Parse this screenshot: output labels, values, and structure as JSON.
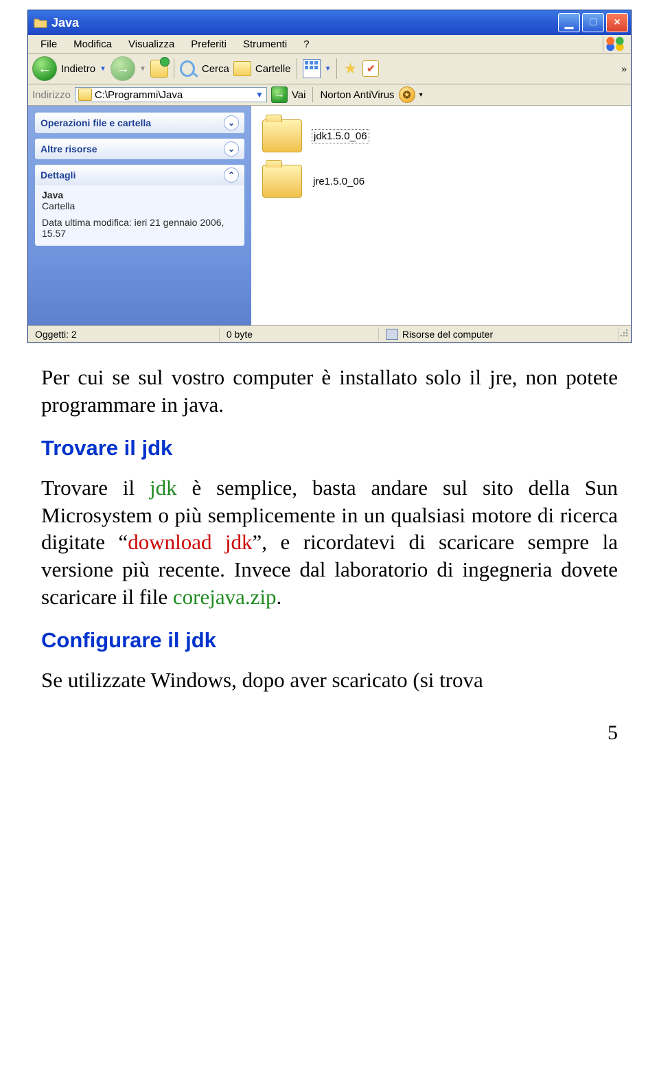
{
  "window": {
    "title": "Java",
    "menus": [
      "File",
      "Modifica",
      "Visualizza",
      "Preferiti",
      "Strumenti",
      "?"
    ],
    "toolbar": {
      "back_label": "Indietro",
      "search_label": "Cerca",
      "folders_label": "Cartelle",
      "overflow": "»"
    },
    "address": {
      "label": "Indirizzo",
      "path": "C:\\Programmi\\Java",
      "go_label": "Vai",
      "antivirus_label": "Norton AntiVirus"
    },
    "sidepane": {
      "panels": [
        {
          "title": "Operazioni file e cartella"
        },
        {
          "title": "Altre risorse"
        },
        {
          "title": "Dettagli",
          "details_title": "Java",
          "details_type": "Cartella",
          "details_date": "Data ultima modifica: ieri 21 gennaio 2006, 15.57"
        }
      ]
    },
    "files": [
      {
        "name": "jdk1.5.0_06",
        "selected": true
      },
      {
        "name": "jre1.5.0_06",
        "selected": false
      }
    ],
    "status": {
      "objects": "Oggetti: 2",
      "size": "0 byte",
      "location": "Risorse del computer"
    }
  },
  "doc": {
    "p1": "Per cui se sul vostro computer è installato solo il jre, non potete programmare in java.",
    "h_find": "Trovare il jdk",
    "p2a": "Trovare il ",
    "p2_jdk": "jdk",
    "p2b": " è semplice, basta andare sul sito della Sun Microsystem o più semplicemente in un qualsiasi motore di ricerca digitate “",
    "p2_dl": "download jdk",
    "p2c": "”, e ricordatevi di scaricare sempre la versione più recente. Invece dal laboratorio di ingegneria dovete scaricare il file ",
    "p2_core": "corejava.zip",
    "p2d": ".",
    "h_conf": "Configurare il jdk",
    "p3": "Se utilizzate Windows, dopo aver scaricato (si trova",
    "page": "5"
  }
}
